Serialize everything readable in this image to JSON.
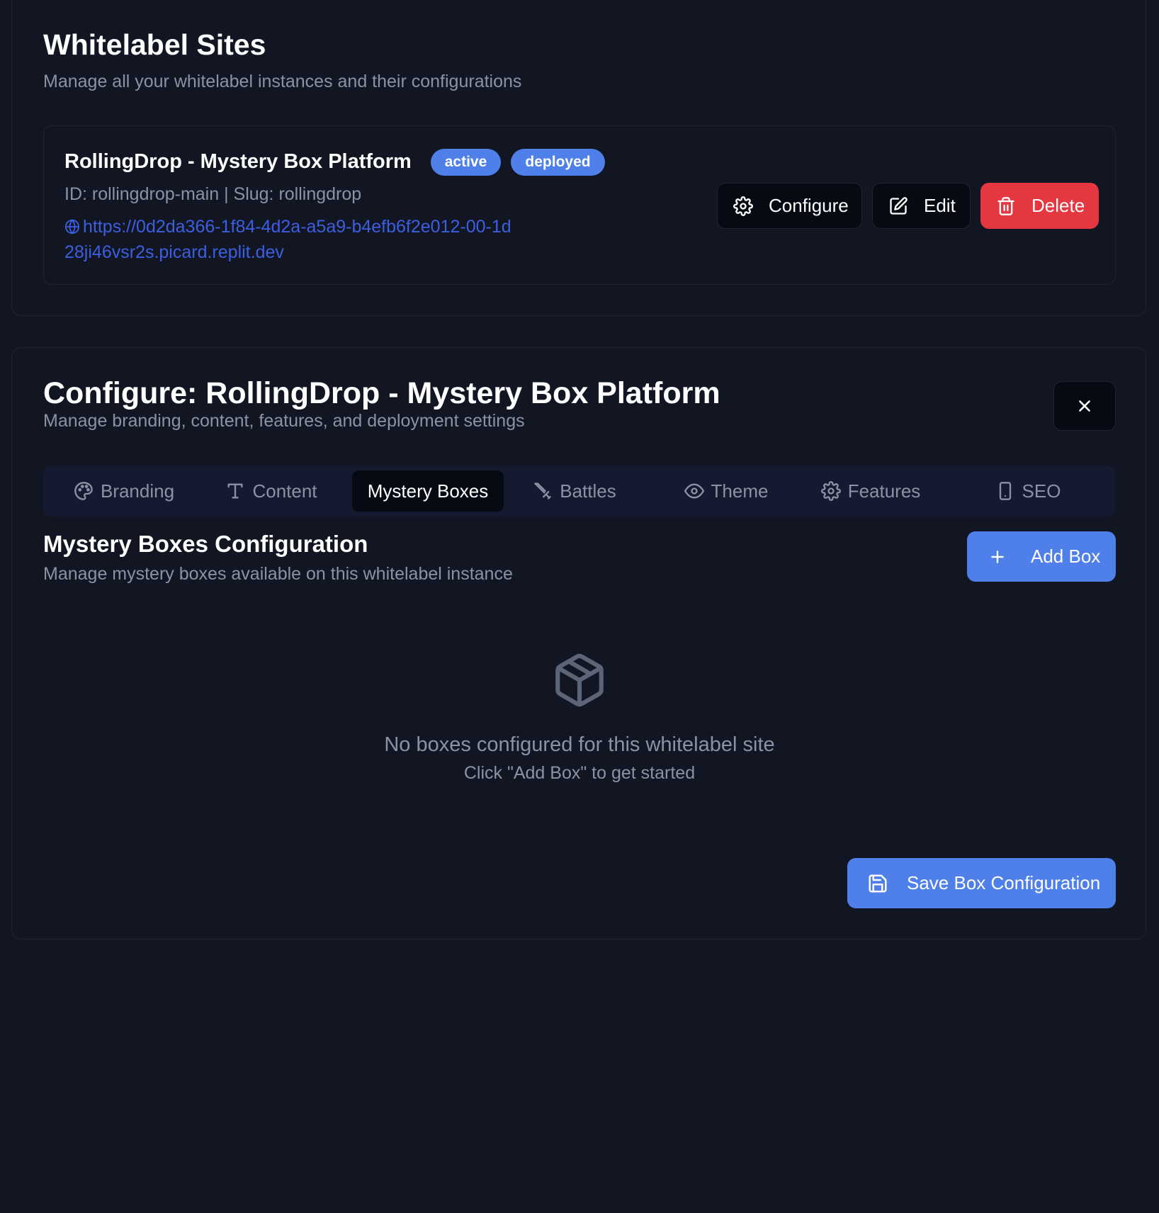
{
  "sites": {
    "title": "Whitelabel Sites",
    "subtitle": "Manage all your whitelabel instances and their configurations",
    "card": {
      "name": "RollingDrop - Mystery Box Platform",
      "badges": [
        "active",
        "deployed"
      ],
      "meta": "ID: rollingdrop-main | Slug: rollingdrop",
      "url": "https://0d2da366-1f84-4d2a-a5a9-b4efb6f2e012-00-1d28ji46vsr2s.picard.replit.dev",
      "actions": {
        "configure": "Configure",
        "edit": "Edit",
        "delete": "Delete"
      }
    }
  },
  "config": {
    "title": "Configure: RollingDrop - Mystery Box Platform",
    "subtitle": "Manage branding, content, features, and deployment settings",
    "tabs": [
      {
        "label": "Branding",
        "icon": "palette-icon"
      },
      {
        "label": "Content",
        "icon": "type-icon"
      },
      {
        "label": "Mystery Boxes",
        "icon": "",
        "active": true
      },
      {
        "label": "Battles",
        "icon": "swords-icon"
      },
      {
        "label": "Theme",
        "icon": "eye-icon"
      },
      {
        "label": "Features",
        "icon": "gear-icon"
      },
      {
        "label": "SEO",
        "icon": "smartphone-icon"
      }
    ],
    "section": {
      "title": "Mystery Boxes Configuration",
      "subtitle": "Manage mystery boxes available on this whitelabel instance",
      "add_label": "Add Box",
      "empty_title": "No boxes configured for this whitelabel site",
      "empty_hint": "Click \"Add Box\" to get started",
      "save_label": "Save Box Configuration"
    }
  },
  "colors": {
    "background": "#121622",
    "accent": "#4f7fe8",
    "danger": "#e5373f",
    "link": "#3b5fe0",
    "muted_text": "#8a93a6"
  }
}
